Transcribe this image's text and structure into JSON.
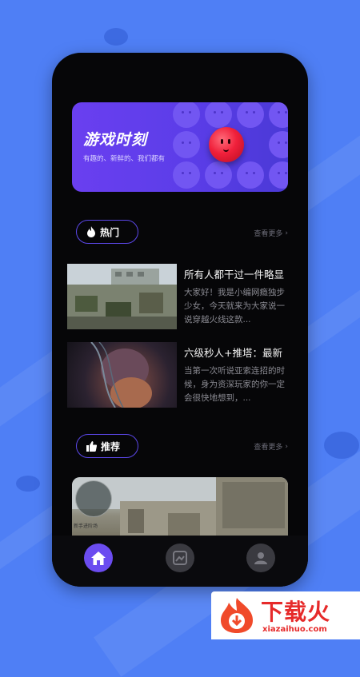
{
  "banner": {
    "title": "游戏时刻",
    "subtitle": "有趣的、新鲜的、我们都有"
  },
  "sections": {
    "hot": {
      "label": "热门",
      "more": "查看更多"
    },
    "recommend": {
      "label": "推荐",
      "more": "查看更多"
    }
  },
  "articles": [
    {
      "title": "所有人都干过一件略显",
      "desc": "大家好！我是小编网瘾独步少女，今天就来为大家说一说穿越火线这款..."
    },
    {
      "title": "六级秒人+推塔：最新",
      "desc": "当第一次听说亚索连招的时候，身为资深玩家的你一定会很快地想到，..."
    }
  ],
  "featured": {
    "minimap_label": "新手进阶场"
  },
  "nav": {
    "items": [
      {
        "name": "home",
        "icon": "home-icon",
        "active": true
      },
      {
        "name": "gallery",
        "icon": "image-icon",
        "active": false
      },
      {
        "name": "profile",
        "icon": "user-icon",
        "active": false
      }
    ],
    "active_color": "#6b4cf0"
  },
  "watermark": {
    "text": "下载火",
    "url": "xiazaihuo.com"
  },
  "colors": {
    "background": "#4f7ff5",
    "accent": "#6b4cf0",
    "card": "#060608"
  }
}
